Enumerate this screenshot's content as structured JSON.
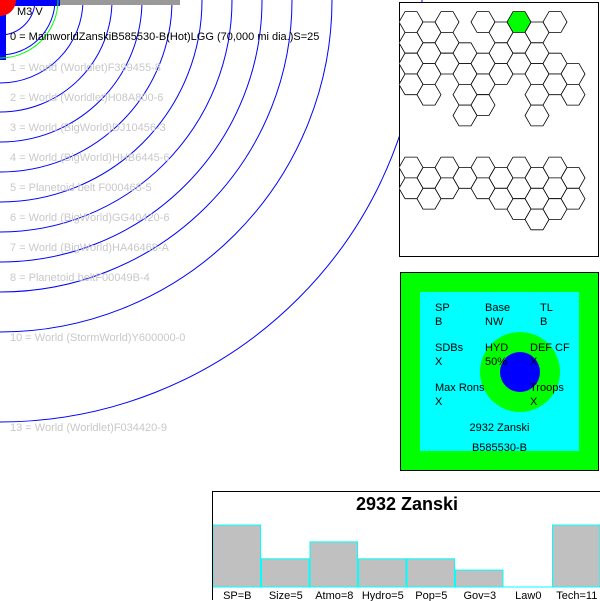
{
  "system": {
    "star_label": "M3 V",
    "orbits": [
      {
        "label": "0 = MainworldZanskiB585530-B(Hot)LGG (70,000 mi dia.)S=25",
        "main": true
      },
      {
        "label": "1 = World  (Worldlet)F399455-8",
        "main": false
      },
      {
        "label": "2 = World  (Worldlet)H08A800-6",
        "main": false
      },
      {
        "label": "3 = World  (BigWorld)DJ10456-3",
        "main": false
      },
      {
        "label": "4 = World  (BigWorld)HHB6445-6",
        "main": false
      },
      {
        "label": "5 = Planetoid belt F000468-5",
        "main": false
      },
      {
        "label": "6 = World  (BigWorld)GG40420-6",
        "main": false
      },
      {
        "label": "7 = World  (BigWorld)HA46468-A",
        "main": false
      },
      {
        "label": "8 = Planetoid beltF00049B-4",
        "main": false
      },
      {
        "label": "10 = World  (StormWorld)Y600000-0",
        "main": false
      },
      {
        "label": "13 = World  (Worldlet)F034420-9",
        "main": false
      }
    ]
  },
  "planet": {
    "sp_label": "SP",
    "sp_value": "B",
    "base_label": "Base",
    "base_value": "NW",
    "tl_label": "TL",
    "tl_value": "B",
    "sdbs_label": "SDBs",
    "sdbs_value": "X",
    "hyd_label": "HYD",
    "hyd_value": "50%",
    "def_label": "DEF CF",
    "def_value": "X",
    "maxrons_label": "Max Rons",
    "maxrons_value": "X",
    "troops_label": "Troops",
    "troops_value": "X",
    "name": "2932 Zanski",
    "uwp": "B585530-B"
  },
  "chart_data": {
    "type": "bar",
    "title": "2932 Zanski",
    "categories": [
      "SP=B",
      "Size=5",
      "Atmo=8",
      "Hydro=5",
      "Pop=5",
      "Gov=3",
      "Law0",
      "Tech=11"
    ],
    "values": [
      11,
      5,
      8,
      5,
      5,
      3,
      0,
      11
    ],
    "ylim": [
      0,
      11
    ],
    "grid": false,
    "colors": {
      "bar_fill": "#c0c0c0",
      "bar_stroke": "#00ffff"
    }
  },
  "colors": {
    "orbit": "#0000ff",
    "hex_highlight": "#00ff00",
    "planet_outer": "#00ff00",
    "planet_inner": "#00ffff",
    "planet_core": "#0000ff",
    "star": "#ff0000"
  }
}
